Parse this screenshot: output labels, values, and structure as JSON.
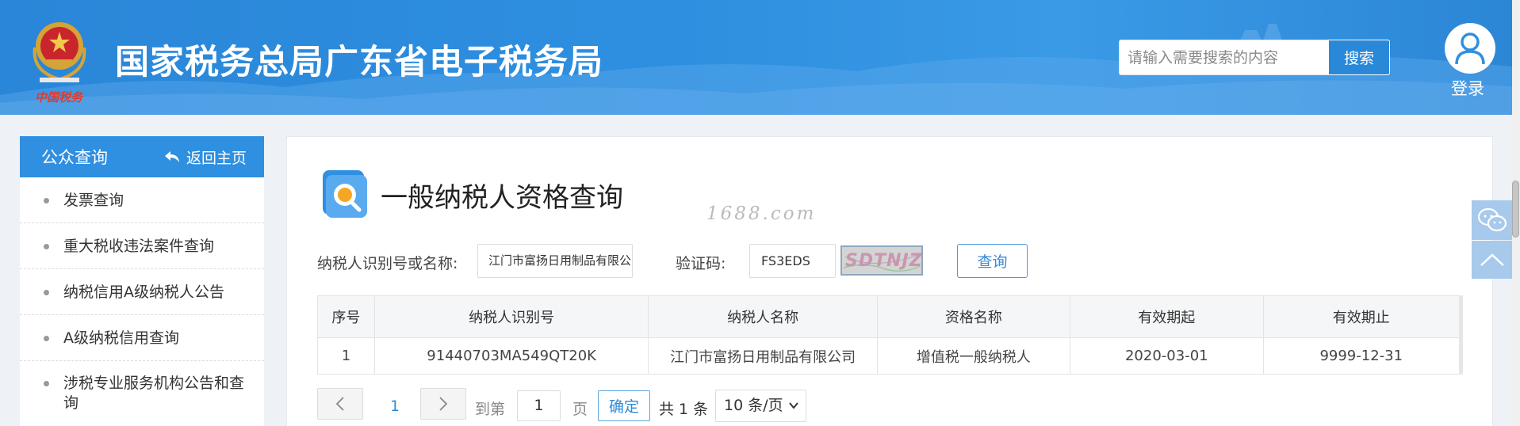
{
  "header": {
    "site_title": "国家税务总局广东省电子税务局",
    "search_placeholder": "请输入需要搜索的内容",
    "search_button": "搜索",
    "login_label": "登录",
    "emblem_caption": "中国税务"
  },
  "sidebar": {
    "title": "公众查询",
    "back_home": "返回主页",
    "items": [
      {
        "label": "发票查询"
      },
      {
        "label": "重大税收违法案件查询"
      },
      {
        "label": "纳税信用A级纳税人公告"
      },
      {
        "label": "A级纳税信用查询"
      },
      {
        "label": "涉税专业服务机构公告和查询"
      }
    ]
  },
  "main": {
    "page_title": "一般纳税人资格查询",
    "watermark": "1688.com",
    "form": {
      "taxpayer_label": "纳税人识别号或名称:",
      "taxpayer_value": "江门市富扬日用制品有限公司",
      "captcha_label": "验证码:",
      "captcha_value": "FS3EDS",
      "captcha_image_text": "SDTNJZ",
      "query_button": "查询"
    },
    "table": {
      "headers": [
        "序号",
        "纳税人识别号",
        "纳税人名称",
        "资格名称",
        "有效期起",
        "有效期止"
      ],
      "rows": [
        [
          "1",
          "91440703MA549QT20K",
          "江门市富扬日用制品有限公司",
          "增值税一般纳税人",
          "2020-03-01",
          "9999-12-31"
        ]
      ]
    },
    "pagination": {
      "current_page": "1",
      "goto_label": "到第",
      "goto_value": "1",
      "page_label": "页",
      "confirm_button": "确定",
      "total_text": "共 1 条",
      "page_size": "10 条/页"
    }
  },
  "colors": {
    "brand_blue": "#2f8fe0",
    "link_blue": "#2e8bd8"
  }
}
